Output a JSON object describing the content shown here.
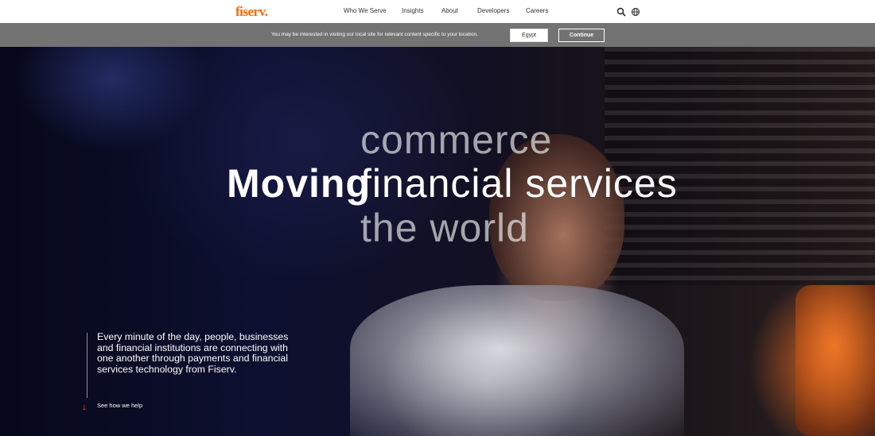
{
  "brand": {
    "logo_text": "fiserv.",
    "accent_color": "#ff6600"
  },
  "nav": {
    "items": [
      {
        "label": "Who We Serve"
      },
      {
        "label": "Insights"
      },
      {
        "label": "About"
      },
      {
        "label": "Developers"
      },
      {
        "label": "Careers"
      }
    ],
    "icons": [
      "search-icon",
      "globe-icon"
    ]
  },
  "location_bar": {
    "message": "You may be interested in visiting our local site for relevant content specific to your location.",
    "selected_country": "Egypt",
    "continue_label": "Continue"
  },
  "hero": {
    "headline_prefix": "Moving",
    "rotating_words": [
      "commerce",
      "financial services",
      "the world"
    ],
    "intro": "Every minute of the day, people, businesses and financial institutions are connecting with one another through payments and financial services technology from Fiserv.",
    "cta_label": "See how we help"
  }
}
